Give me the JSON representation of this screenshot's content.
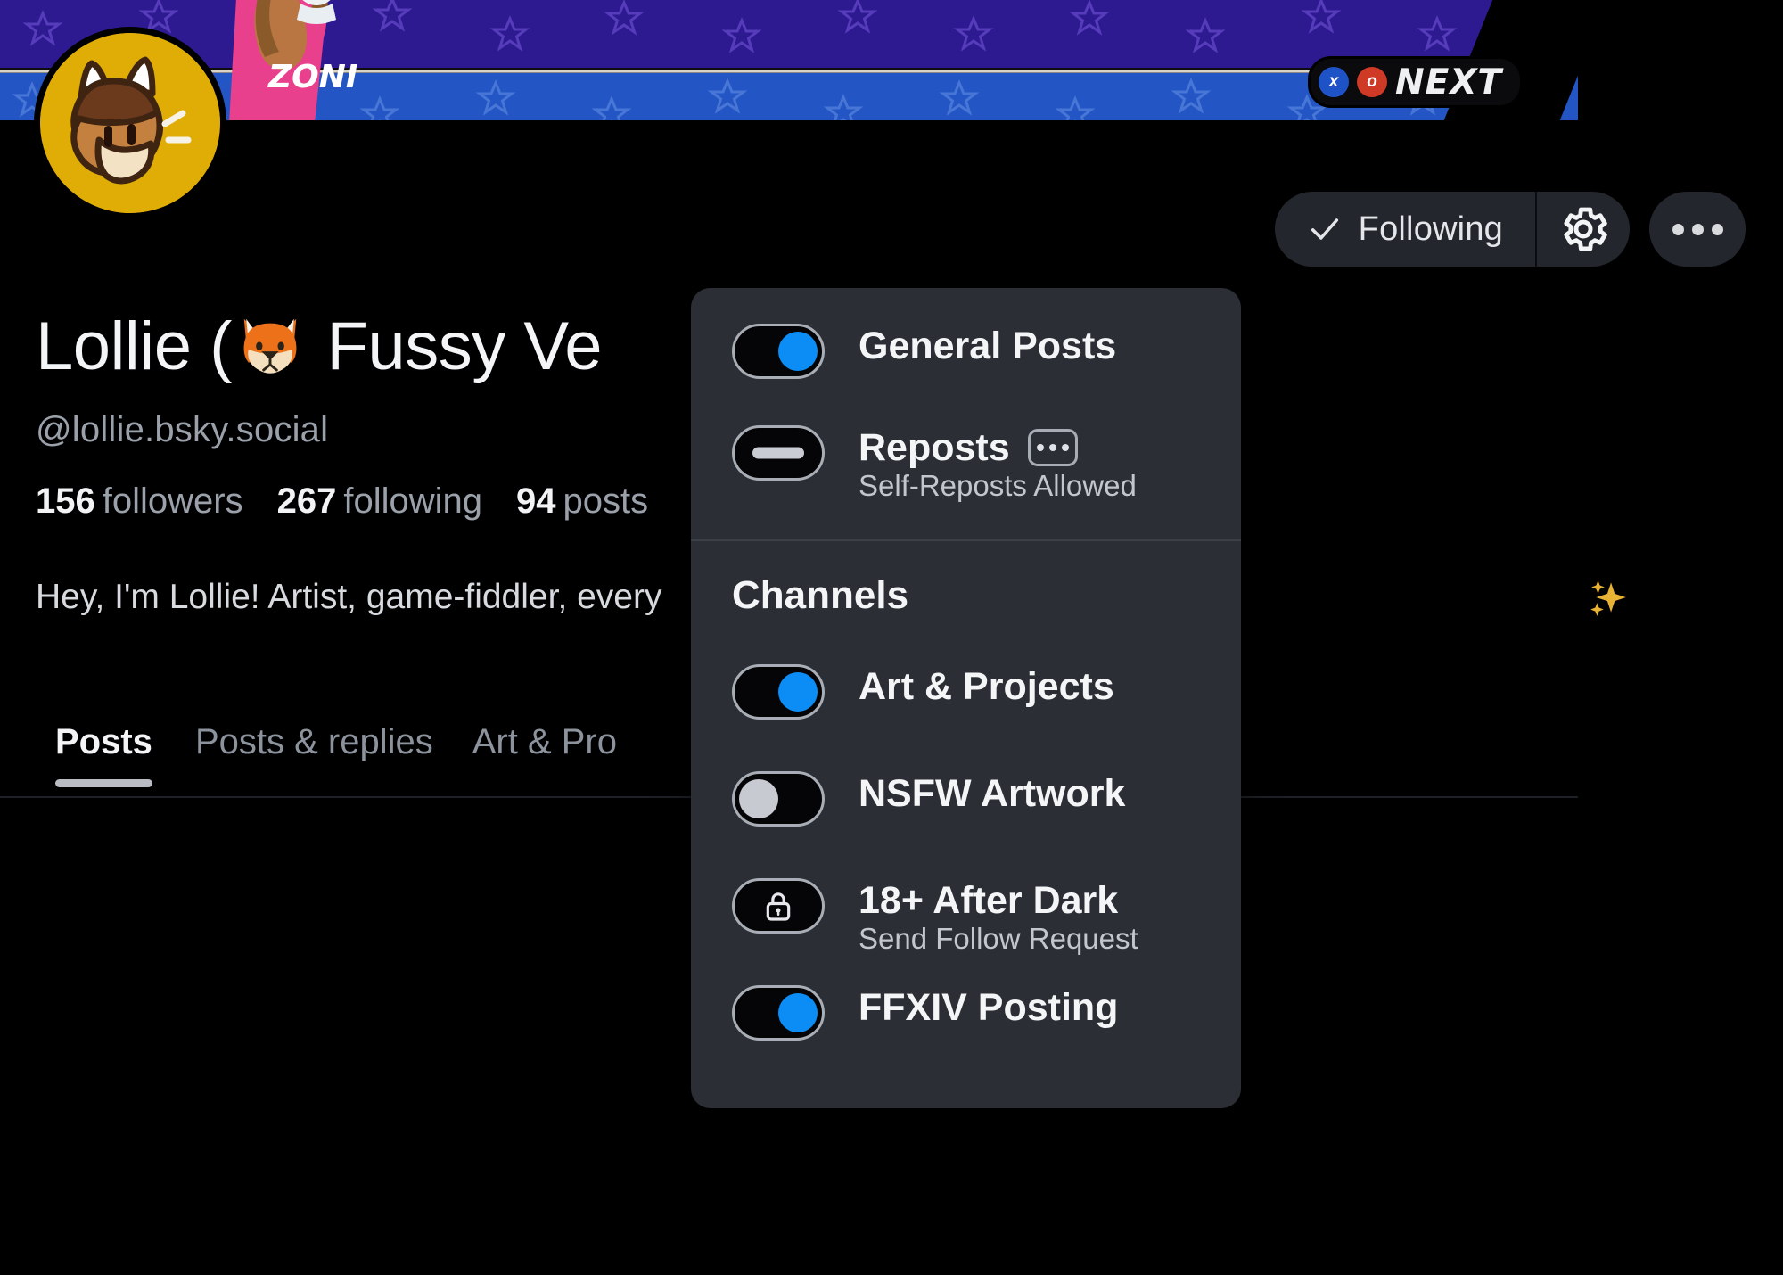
{
  "banner": {
    "next_badge": {
      "x_label": "x",
      "o_label": "o",
      "text": "NEXT"
    }
  },
  "profile": {
    "display_name_before": "Lollie (",
    "display_name_emoji": "fox-face-emoji",
    "display_name_after": " Fussy Ve",
    "handle": "@lollie.bsky.social",
    "stats": [
      {
        "value": "156",
        "label": "followers"
      },
      {
        "value": "267",
        "label": "following"
      },
      {
        "value": "94",
        "label": "posts"
      }
    ],
    "bio": "Hey, I'm Lollie! Artist, game-fiddler, every",
    "bio_emoji": "sparkles-emoji"
  },
  "header_actions": {
    "following_label": "Following",
    "following_icon": "check-icon",
    "gear_icon": "gear-icon",
    "more_icon": "ellipsis-icon"
  },
  "tabs": [
    {
      "label": "Posts",
      "active": true
    },
    {
      "label": "Posts & replies",
      "active": false
    },
    {
      "label": "Art & Pro",
      "active": false
    }
  ],
  "dropdown": {
    "top_items": [
      {
        "title": "General Posts",
        "subtitle": "",
        "toggle": "on",
        "has_menu": false
      },
      {
        "title": "Reposts",
        "subtitle": "Self-Reposts Allowed",
        "toggle": "dash",
        "has_menu": true
      }
    ],
    "section_title": "Channels",
    "channels": [
      {
        "title": "Art & Projects",
        "subtitle": "",
        "toggle": "on"
      },
      {
        "title": "NSFW Artwork",
        "subtitle": "",
        "toggle": "off"
      },
      {
        "title": "18+ After Dark",
        "subtitle": "Send Follow Request",
        "toggle": "lock"
      },
      {
        "title": "FFXIV Posting",
        "subtitle": "",
        "toggle": "on"
      }
    ]
  },
  "colors": {
    "accent_blue": "#0b8df5",
    "panel_bg": "#2b2e34",
    "button_bg": "#23262c",
    "banner_blue": "#2355c4",
    "banner_purple": "#2e1a90",
    "avatar_bg": "#e0ad06",
    "muted_text": "#9ba1aa"
  }
}
